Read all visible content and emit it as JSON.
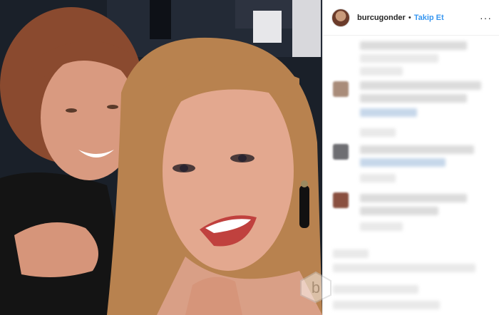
{
  "post": {
    "username": "burcugonder",
    "separator": "•",
    "follow_label": "Takip Et",
    "more_label": "···"
  },
  "colors": {
    "link_blue": "#3897f0",
    "text_dark": "#262626",
    "border": "#efefef"
  },
  "icons": {
    "more": "more-options-icon",
    "avatar": "profile-avatar"
  }
}
